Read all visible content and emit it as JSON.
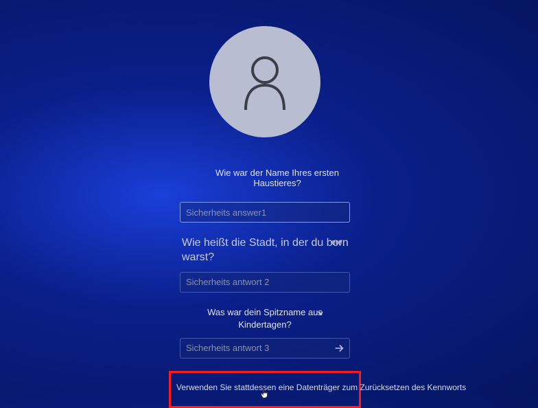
{
  "username": "      ",
  "questions": {
    "q1": "Wie war der Name Ihres ersten Haustieres?",
    "q2_line": "Wie heißt die Stadt, in der du born warst?",
    "q2_hint": "ere",
    "q3": "Was war dein Spitzname aus Kindertagen?"
  },
  "placeholders": {
    "a1": "Sicherheits answer1",
    "a2": "Sicherheits antwort 2",
    "a3": "Sicherheits antwort 3"
  },
  "reset_link": "Verwenden Sie stattdessen eine Datenträger zum Zurücksetzen des Kennworts"
}
